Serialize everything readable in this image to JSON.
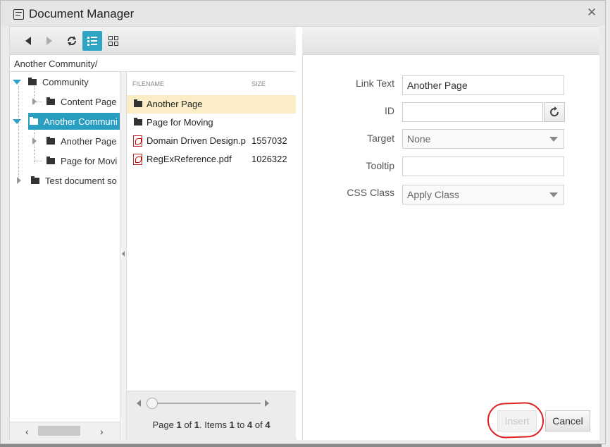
{
  "window": {
    "title": "Document Manager"
  },
  "toolbar": {
    "back_icon": "arrow-left-icon",
    "forward_icon": "arrow-right-icon",
    "refresh_icon": "refresh-icon",
    "list_view_icon": "list-view-icon",
    "thumb_view_icon": "grid-view-icon",
    "accent": "#2fa4c4"
  },
  "path": "Another Community/",
  "tree": {
    "items": [
      {
        "label": "Community"
      },
      {
        "label": "Content Page"
      },
      {
        "label": "Another Communi"
      },
      {
        "label": "Another Page"
      },
      {
        "label": "Page for Movi"
      },
      {
        "label": "Test document so"
      }
    ]
  },
  "file_list": {
    "header_name": "FILENAME",
    "header_size": "SIZE",
    "rows": [
      {
        "name": "Another Page",
        "size": "",
        "type": "folder"
      },
      {
        "name": "Page for Moving",
        "size": "",
        "type": "folder"
      },
      {
        "name": "Domain Driven Design.p",
        "size": "1557032",
        "type": "pdf"
      },
      {
        "name": "RegExReference.pdf",
        "size": "1026322",
        "type": "pdf"
      }
    ]
  },
  "pager": {
    "prefix": "Page",
    "page": "1",
    "of": "of",
    "total_pages": "1",
    "items_label": ". Items",
    "from": "1",
    "to_word": "to",
    "to": "4",
    "of2": "of",
    "total": "4"
  },
  "properties": {
    "link_text_label": "Link Text",
    "link_text_value": "Another Page",
    "id_label": "ID",
    "id_value": "",
    "target_label": "Target",
    "target_value": "None",
    "tooltip_label": "Tooltip",
    "tooltip_value": "",
    "css_class_label": "CSS Class",
    "css_class_value": "Apply Class"
  },
  "buttons": {
    "insert": "Insert",
    "cancel": "Cancel"
  }
}
